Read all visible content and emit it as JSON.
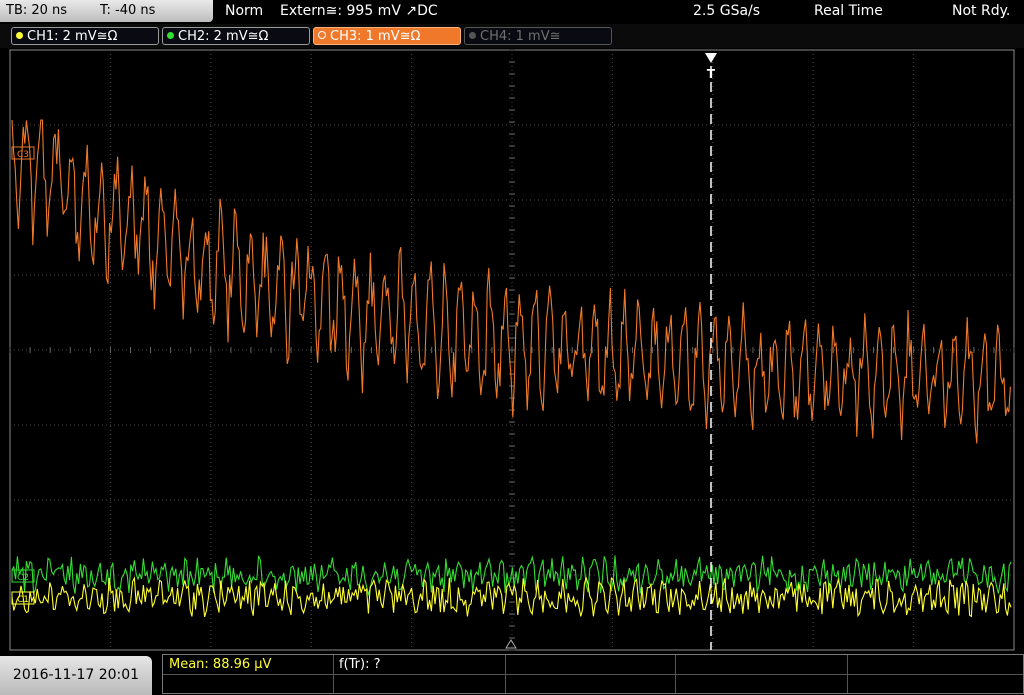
{
  "header": {
    "timebase": "TB: 20 ns",
    "trigger_time": "T: -40 ns",
    "trigger_mode": "Norm",
    "trigger_source": "Extern≅: 995 mV ↗DC",
    "sample_rate": "2.5 GSa/s",
    "acq_mode": "Real Time",
    "status": "Not Rdy."
  },
  "channels": [
    {
      "label": "CH1: 2 mV≅Ω",
      "color": "#ffff33",
      "state": "on"
    },
    {
      "label": "CH2: 2 mV≅Ω",
      "color": "#33dd33",
      "state": "on"
    },
    {
      "label": "CH3: 1 mV≅Ω",
      "color": "#f0782a",
      "state": "active"
    },
    {
      "label": "CH4: 1 mV≅",
      "color": "#777777",
      "state": "off"
    }
  ],
  "trigger_marker": "T",
  "markers": {
    "ch3": "C3",
    "ch2": "C2",
    "ch1": "C1"
  },
  "footer": {
    "datetime": "2016-11-17 20:01",
    "mean": "Mean: 88.96 µV",
    "freq": "f(Tr): ?"
  },
  "colors": {
    "ch1": "#ffff33",
    "ch2": "#33dd33",
    "ch3": "#f0782a",
    "grid": "#3a3a3a"
  }
}
